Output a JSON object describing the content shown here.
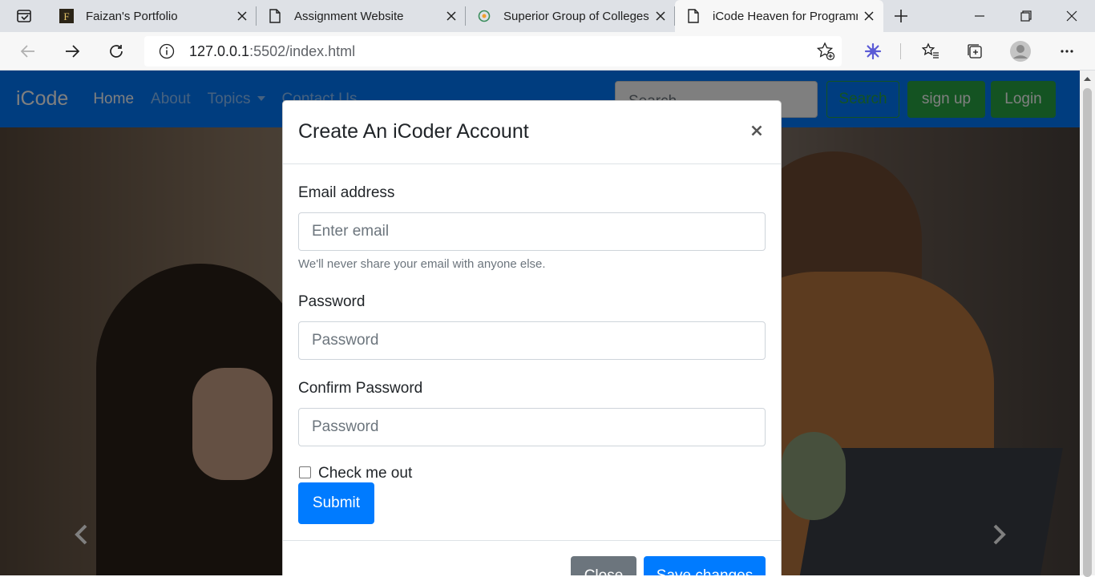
{
  "browser": {
    "tabs": [
      {
        "title": "Faizan's Portfolio",
        "favicon": "letter-F-icon"
      },
      {
        "title": "Assignment Website",
        "favicon": "page-icon"
      },
      {
        "title": "Superior Group of Colleges",
        "favicon": "globe-icon"
      },
      {
        "title": "iCode Heaven for Programmers",
        "favicon": "page-icon"
      }
    ],
    "active_tab": 3,
    "url_host": "127.0.0.1",
    "url_rest": ":5502/index.html"
  },
  "navbar": {
    "brand": "iCode",
    "links": [
      "Home",
      "About",
      "Topics",
      "Contact Us"
    ],
    "search_placeholder": "Search",
    "search_button": "Search",
    "signup": "sign up",
    "login": "Login"
  },
  "modal": {
    "title": "Create An iCoder Account",
    "email_label": "Email address",
    "email_placeholder": "Enter email",
    "email_help": "We'll never share your email with anyone else.",
    "password_label": "Password",
    "password_placeholder": "Password",
    "confirm_label": "Confirm Password",
    "confirm_placeholder": "Password",
    "checkbox_label": "Check me out",
    "submit": "Submit",
    "close": "Close",
    "save": "Save changes"
  },
  "colors": {
    "navbar": "#007bff",
    "primary": "#007bff",
    "success": "#28a745",
    "secondary": "#6c757d"
  }
}
